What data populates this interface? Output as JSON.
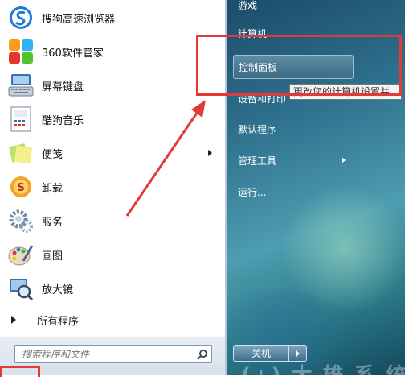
{
  "left_items": [
    {
      "label": "搜狗高速浏览器",
      "icon": "sogou-browser-icon"
    },
    {
      "label": "360软件管家",
      "icon": "360-software-manager-icon"
    },
    {
      "label": "屏幕键盘",
      "icon": "on-screen-keyboard-icon"
    },
    {
      "label": "酷狗音乐",
      "icon": "kugou-music-icon"
    },
    {
      "label": "便笺",
      "icon": "sticky-notes-icon"
    },
    {
      "label": "卸载",
      "icon": "uninstall-icon"
    },
    {
      "label": "服务",
      "icon": "services-icon"
    },
    {
      "label": "画图",
      "icon": "paint-icon"
    },
    {
      "label": "放大镜",
      "icon": "magnifier-icon"
    }
  ],
  "all_programs": "所有程序",
  "search": {
    "placeholder": "搜索程序和文件"
  },
  "right_items": [
    {
      "label": "游戏"
    },
    {
      "label": "计算机"
    },
    {
      "label": "控制面板"
    },
    {
      "label": "设备和打印"
    },
    {
      "label": "默认程序"
    },
    {
      "label": "管理工具"
    },
    {
      "label": "运行..."
    }
  ],
  "tooltip": "更改您的计算机设置并",
  "shutdown": {
    "label": "关机"
  },
  "watermark": "(+) 大 雄 系 统",
  "colors": {
    "annotation_red": "#e23a3a",
    "pane_blue": "#2d6f8c"
  }
}
